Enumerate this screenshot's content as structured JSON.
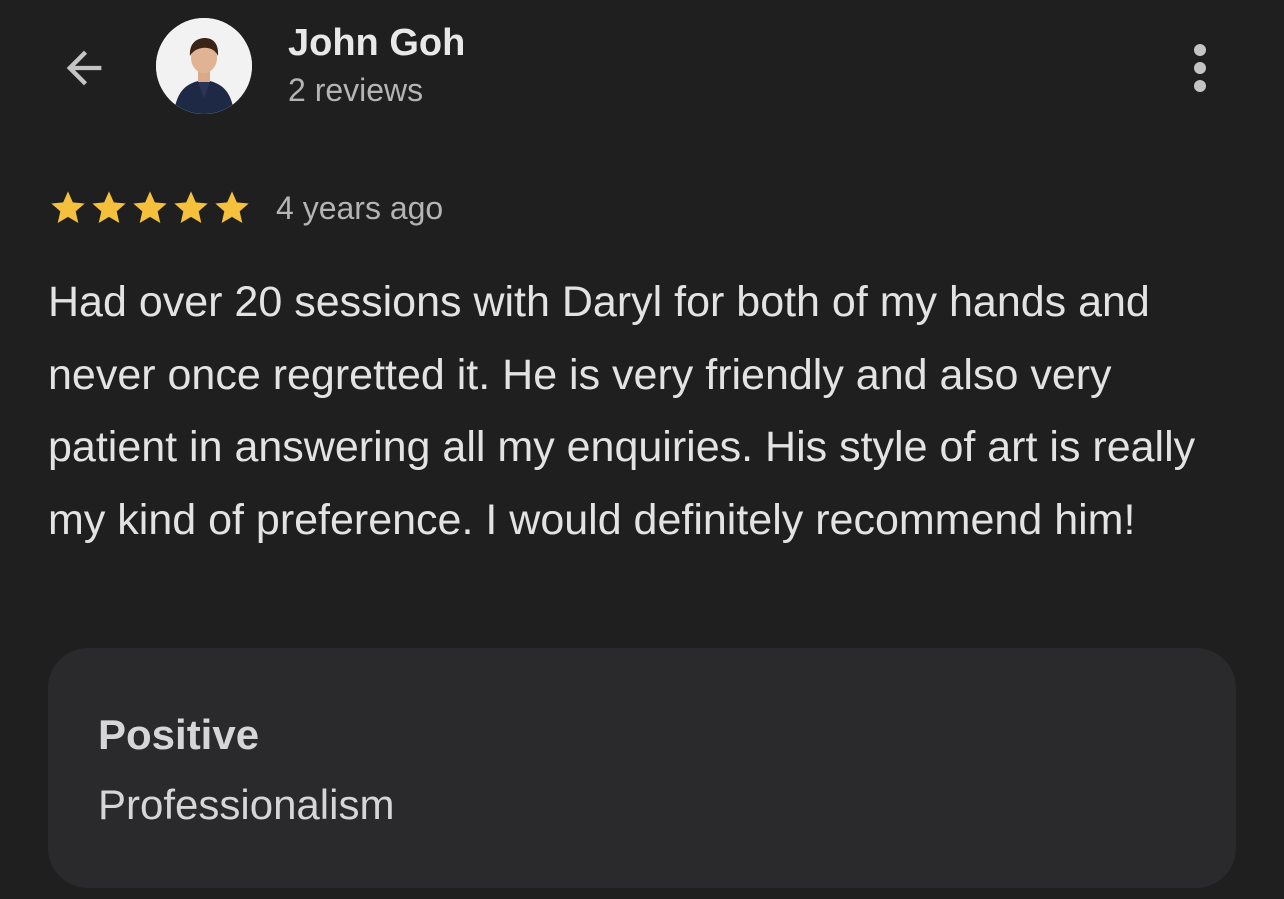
{
  "header": {
    "back_icon": "arrow-back-icon",
    "user_name": "John Goh",
    "review_count": "2 reviews",
    "more_icon": "more-vert-icon"
  },
  "review": {
    "rating": 5,
    "rating_max": 5,
    "star_color": "#f5c13d",
    "age": "4 years ago",
    "text": "Had over 20 sessions with Daryl for both of my hands and never once regretted it. He is very friendly and also very patient in answering all my enquiries. His style of art is really my kind of preference. I would definitely recommend him!"
  },
  "attributes": {
    "heading": "Positive",
    "value": "Professionalism"
  }
}
